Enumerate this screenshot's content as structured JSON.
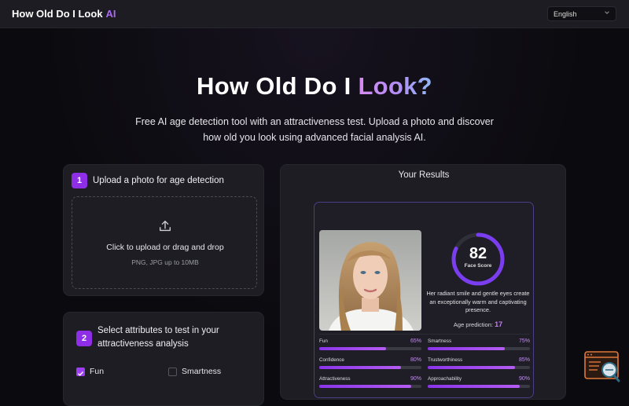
{
  "header": {
    "brand": "How Old Do I Look",
    "brand_accent": "AI",
    "language": "English"
  },
  "hero": {
    "title_prefix": "How Old Do I ",
    "title_accent": "Look?",
    "subtitle": "Free AI age detection tool with an attractiveness test. Upload a photo and discover how old you look using advanced facial analysis AI."
  },
  "upload": {
    "step": "1",
    "title": "Upload a photo for age detection",
    "dropzone_main": "Click to upload or drag and drop",
    "dropzone_sub": "PNG, JPG up to 10MB"
  },
  "attributes": {
    "step": "2",
    "title": "Select attributes to test in your attractiveness analysis",
    "options": [
      {
        "label": "Fun",
        "checked": true
      },
      {
        "label": "Smartness",
        "checked": false
      }
    ]
  },
  "results": {
    "title": "Your Results",
    "score": "82",
    "score_value": 82,
    "score_label": "Face Score",
    "description": "Her radiant smile and gentle eyes create an exceptionally warm and captivating presence.",
    "age_label": "Age prediction:",
    "age_value": "17",
    "metrics": [
      {
        "label": "Fun",
        "value": "65%",
        "pct": 65
      },
      {
        "label": "Smartness",
        "value": "75%",
        "pct": 75
      },
      {
        "label": "Confidence",
        "value": "80%",
        "pct": 80
      },
      {
        "label": "Trustworthiness",
        "value": "85%",
        "pct": 85
      },
      {
        "label": "Attractiveness",
        "value": "90%",
        "pct": 90
      },
      {
        "label": "Approachability",
        "value": "90%",
        "pct": 90
      }
    ]
  },
  "colors": {
    "accent": "#8e2ee6",
    "background": "#0b0b0f",
    "card": "#1d1d23"
  }
}
